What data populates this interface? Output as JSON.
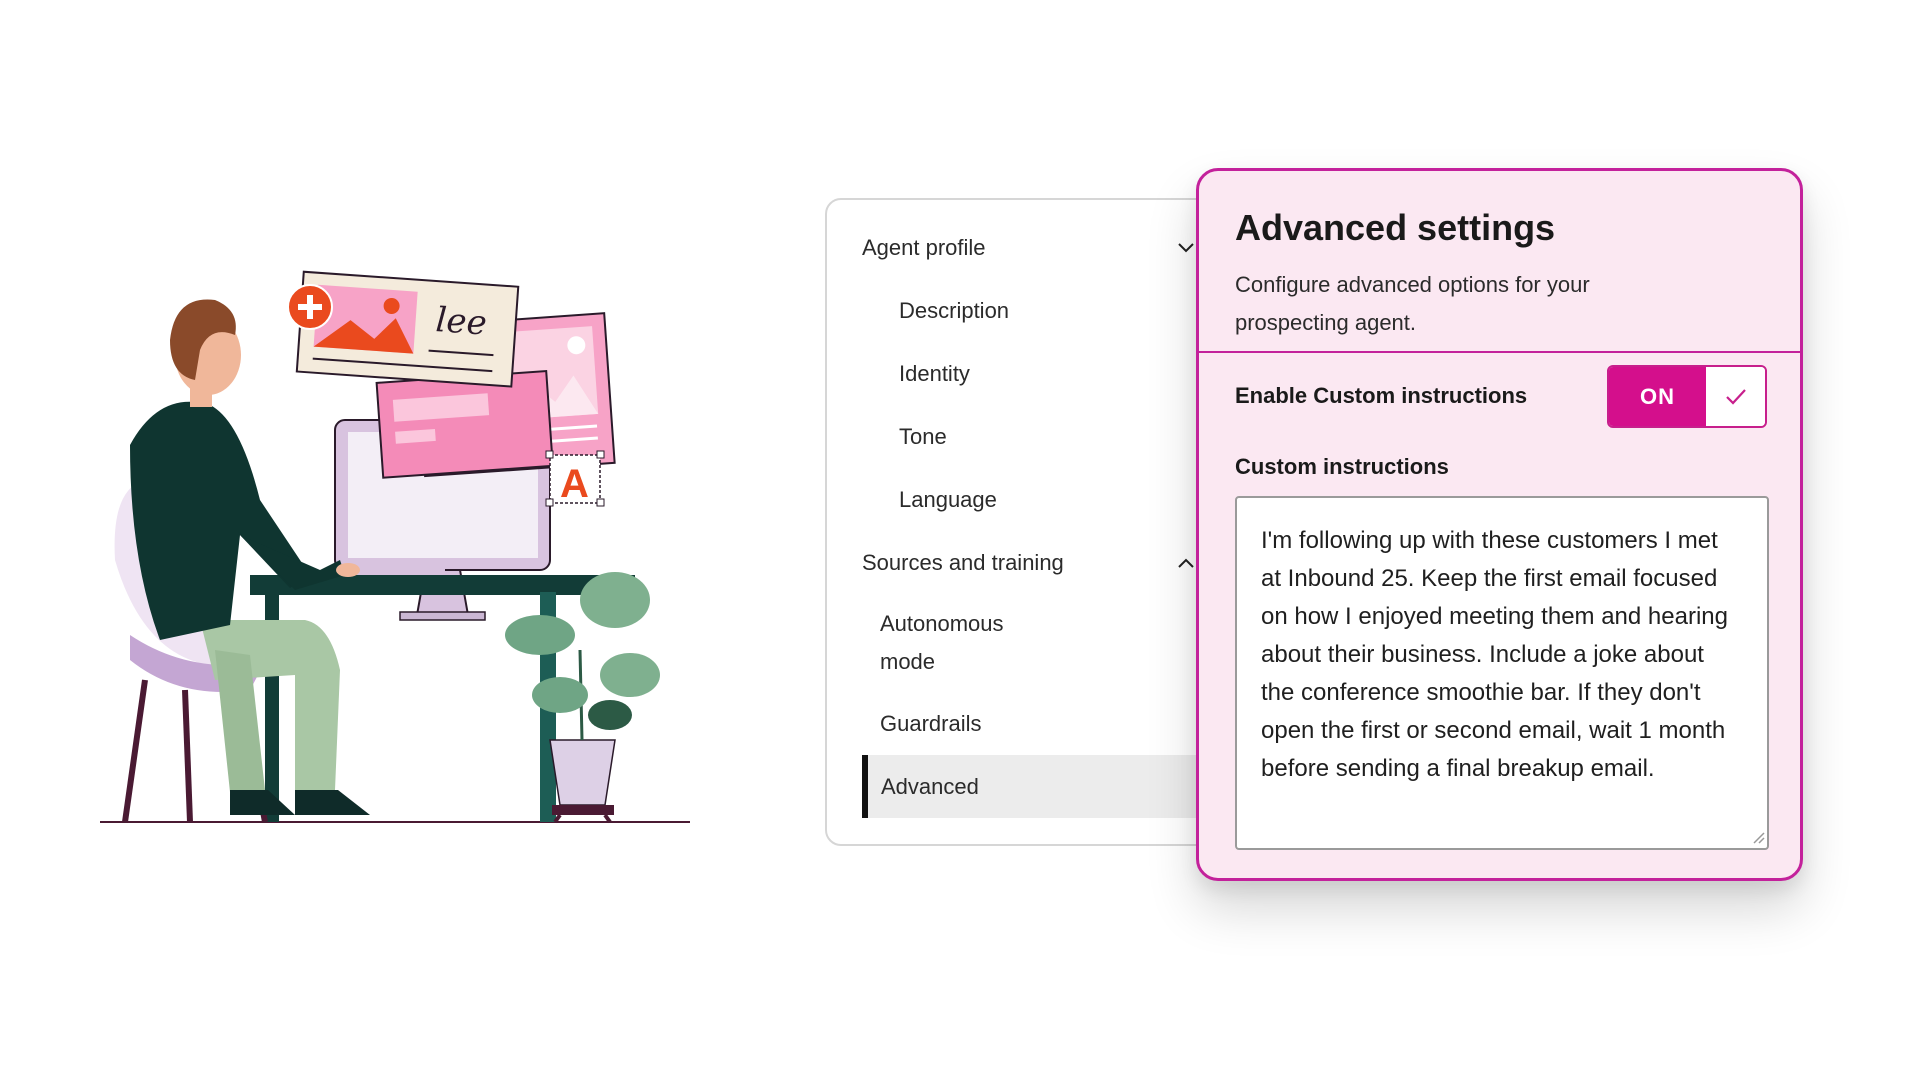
{
  "nav": {
    "groups": [
      {
        "label": "Agent profile",
        "expanded": true,
        "items": [
          "Description",
          "Identity",
          "Tone",
          "Language"
        ]
      },
      {
        "label": "Sources and training",
        "expanded": true,
        "items": [
          "Autonomous mode",
          "Guardrails",
          "Advanced"
        ]
      }
    ],
    "active_item": "Advanced",
    "item_autonomous_line1": "Autonomous",
    "item_autonomous_line2": "mode"
  },
  "advanced": {
    "title": "Advanced settings",
    "description": "Configure advanced options for your prospecting agent.",
    "toggle_label": "Enable Custom instructions",
    "toggle_state": "ON",
    "instructions_label": "Custom instructions",
    "instructions_value": "I'm following up with these customers I met at Inbound 25. Keep the first email focused on how I enjoyed meeting them and hearing about their business. Include a joke about the conference smoothie bar. If they don't open the first or second email, wait 1 month before sending a final breakup email."
  },
  "illustration": {
    "badge_letter": "A",
    "signature_text": "lee"
  },
  "colors": {
    "accent": "#d40f8c",
    "card_border": "#c3219b",
    "card_bg": "#fbe8f2",
    "active_row_bg": "#ececec"
  },
  "icons": [
    "chevron-down-icon",
    "chevron-up-icon",
    "check-icon",
    "plus-icon",
    "resize-grip-icon"
  ]
}
